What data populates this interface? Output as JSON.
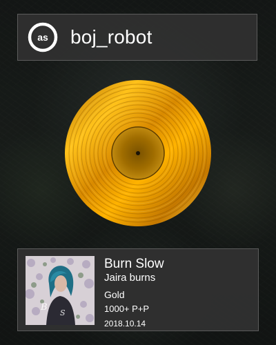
{
  "header": {
    "username": "boj_robot",
    "logo_icon": "lastfm-logo-icon"
  },
  "record": {
    "award_level": "Gold",
    "color": "#f0a000"
  },
  "track": {
    "title": "Burn Slow",
    "artist": "Jaira burns",
    "award": "Gold",
    "plays": "1000+ P+P",
    "date": "2018.10.14"
  },
  "colors": {
    "panel_bg": "#303030",
    "panel_border": "#5c5c5c",
    "text": "#ffffff",
    "gold": "#f0a000"
  }
}
